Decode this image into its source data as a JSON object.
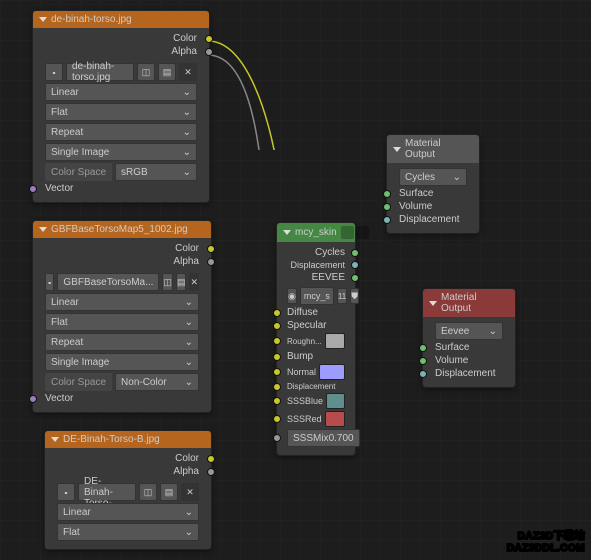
{
  "nodes": {
    "tex1": {
      "title": "de-binah-torso.jpg",
      "out_color": "Color",
      "out_alpha": "Alpha",
      "filename": "de-binah-torso.jpg",
      "interp": "Linear",
      "projection": "Flat",
      "extension": "Repeat",
      "source": "Single Image",
      "colorspace_label": "Color Space",
      "colorspace": "sRGB",
      "in_vector": "Vector"
    },
    "tex2": {
      "title": "GBFBaseTorsoMap5_1002.jpg",
      "out_color": "Color",
      "out_alpha": "Alpha",
      "filename": "GBFBaseTorsoMa...",
      "interp": "Linear",
      "projection": "Flat",
      "extension": "Repeat",
      "source": "Single Image",
      "colorspace_label": "Color Space",
      "colorspace": "Non-Color",
      "in_vector": "Vector"
    },
    "tex3": {
      "title": "DE-Binah-Torso-B.jpg",
      "out_color": "Color",
      "out_alpha": "Alpha",
      "filename": "DE-Binah-Torso-...",
      "interp": "Linear",
      "projection": "Flat"
    },
    "group": {
      "title": "mcy_skin",
      "out_cycles": "Cycles",
      "out_disp": "Displacement",
      "out_eevee": "EEVEE",
      "grp_name": "mcy_s",
      "grp_users": "11",
      "in_diffuse": "Diffuse",
      "in_specular": "Specular",
      "in_rough": "Roughn...",
      "in_bump": "Bump",
      "in_normal": "Normal",
      "in_disp": "Displacement",
      "in_sssblue": "SSSBlue",
      "in_sssred": "SSSRed",
      "in_sssmix_lbl": "SSSMix",
      "in_sssmix_val": "0.700"
    },
    "out1": {
      "title": "Material Output",
      "target": "Cycles",
      "in_surface": "Surface",
      "in_volume": "Volume",
      "in_disp": "Displacement"
    },
    "out2": {
      "title": "Material Output",
      "target": "Eevee",
      "in_surface": "Surface",
      "in_volume": "Volume",
      "in_disp": "Displacement"
    }
  },
  "watermark": {
    "line1": "DAZ3D下载站",
    "line2": "DAZ3DDL.COM"
  },
  "colors": {
    "rough": "#a8a8a8",
    "normal": "#9c9cff",
    "sssblue": "#5f8e8e",
    "sssred": "#b84c4c"
  }
}
